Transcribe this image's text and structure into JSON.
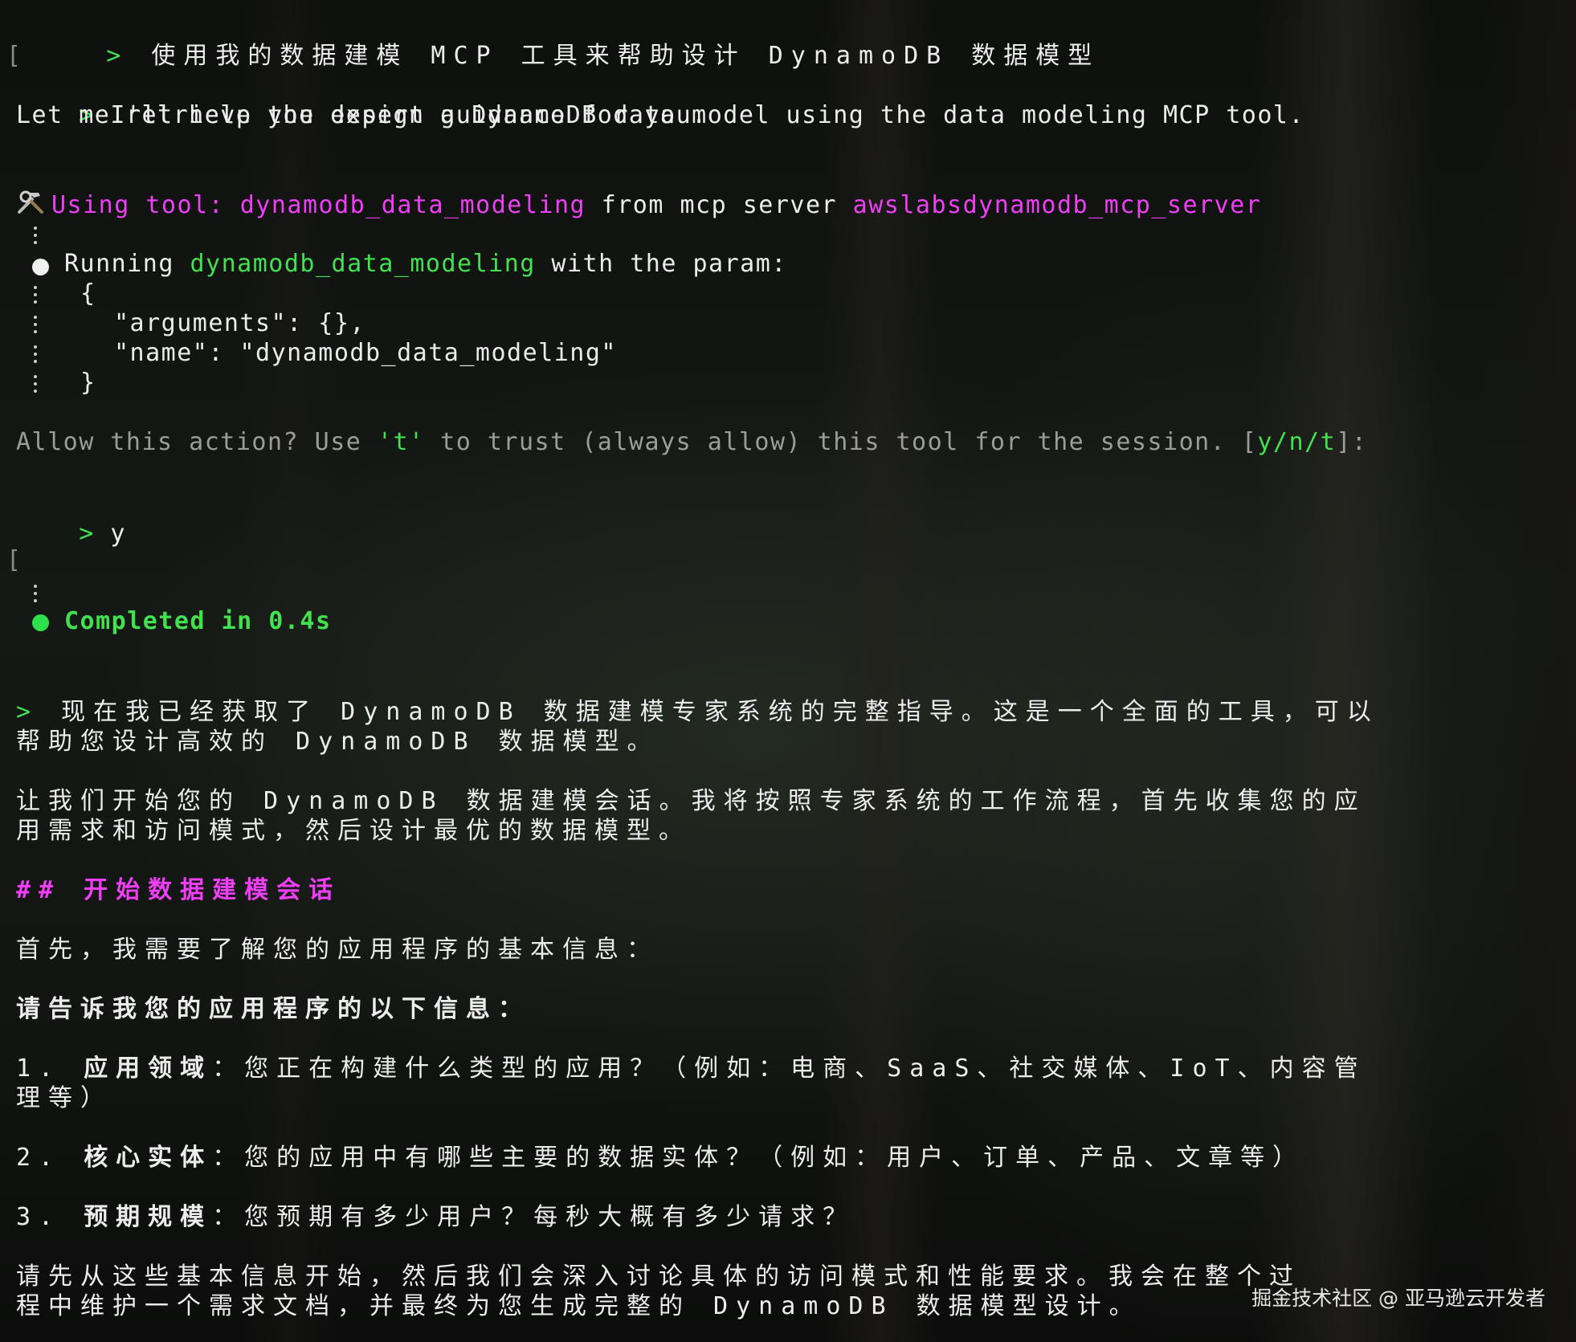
{
  "line1": {
    "prompt": ">",
    "text": "使用我的数据建模 MCP 工具来帮助设计 DynamoDB 数据模型"
  },
  "line2": {
    "prompt": ">",
    "text": "I'll help you design a DynamoDB data model using the data modeling MCP tool."
  },
  "line3": {
    "text": "Let me retrieve the expert guidance for you."
  },
  "tool_line": {
    "icon": "hammer-wrench-icon",
    "using_label": "Using tool:",
    "tool_name": "dynamodb_data_modeling",
    "from_text": "from mcp server",
    "server_name": "awslabsdynamodb_mcp_server"
  },
  "running_line": {
    "prefix": "Running",
    "tool_name": "dynamodb_data_modeling",
    "suffix": "with the param:"
  },
  "json_block": {
    "open": "{",
    "arguments": "\"arguments\": {},",
    "name": "\"name\": \"dynamodb_data_modeling\"",
    "close": "}"
  },
  "allow_prompt": {
    "text1": "Allow this action? Use ",
    "t_key": "'t'",
    "text2": " to trust (always allow) this tool for the session. ",
    "bracket_open": "[",
    "options": "y/n/t",
    "bracket_close": "]:"
  },
  "user_reply": {
    "prompt": ">",
    "text": "y"
  },
  "completed": "Completed in 0.4s",
  "response": {
    "prompt": ">",
    "para1_line1": "现在我已经获取了 DynamoDB 数据建模专家系统的完整指导。这是一个全面的工具，可以",
    "para1_line2": "帮助您设计高效的 DynamoDB 数据模型。",
    "para2_line1": "让我们开始您的 DynamoDB 数据建模会话。我将按照专家系统的工作流程，首先收集您的应",
    "para2_line2": "用需求和访问模式，然后设计最优的数据模型。",
    "heading": "## 开始数据建模会话",
    "para3": "首先，我需要了解您的应用程序的基本信息：",
    "bold_line": "请告诉我您的应用程序的以下信息：",
    "items": [
      {
        "num": "1.",
        "label": "应用领域",
        "text": "：您正在构建什么类型的应用？（例如：电商、SaaS、社交媒体、IoT、内容管",
        "text2": "理等）"
      },
      {
        "num": "2.",
        "label": "核心实体",
        "text": "：您的应用中有哪些主要的数据实体？（例如：用户、订单、产品、文章等）"
      },
      {
        "num": "3.",
        "label": "预期规模",
        "text": "：您预期有多少用户？每秒大概有多少请求？"
      }
    ],
    "closing_line1": "请先从这些基本信息开始，然后我们会深入讨论具体的访问模式和性能要求。我会在整个过",
    "closing_line2": "程中维护一个需求文档，并最终为您生成完整的 DynamoDB 数据模型设计。"
  },
  "watermark": "掘金技术社区 @ 亚马逊云开发者",
  "gutter_bracket": "["
}
